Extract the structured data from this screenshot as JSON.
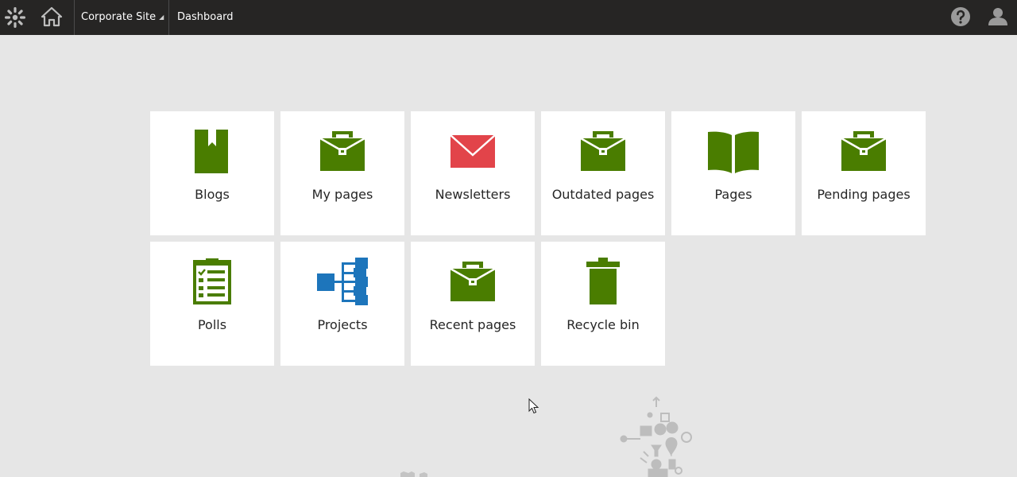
{
  "topbar": {
    "site_name": "Corporate Site",
    "caret": "◢",
    "breadcrumb": "Dashboard"
  },
  "colors": {
    "green": "#4a7d00",
    "red": "#e2444a",
    "blue": "#1d75bb",
    "topbar_bg": "#262524",
    "page_bg": "#e6e6e6"
  },
  "tiles": [
    {
      "label": "Blogs",
      "icon": "bookmark-icon"
    },
    {
      "label": "My pages",
      "icon": "briefcase-icon"
    },
    {
      "label": "Newsletters",
      "icon": "envelope-icon"
    },
    {
      "label": "Outdated pages",
      "icon": "briefcase-icon"
    },
    {
      "label": "Pages",
      "icon": "open-book-icon"
    },
    {
      "label": "Pending pages",
      "icon": "briefcase-icon"
    },
    {
      "label": "Polls",
      "icon": "checklist-icon"
    },
    {
      "label": "Projects",
      "icon": "hierarchy-icon"
    },
    {
      "label": "Recent pages",
      "icon": "briefcase-icon"
    },
    {
      "label": "Recycle bin",
      "icon": "trash-icon"
    }
  ]
}
